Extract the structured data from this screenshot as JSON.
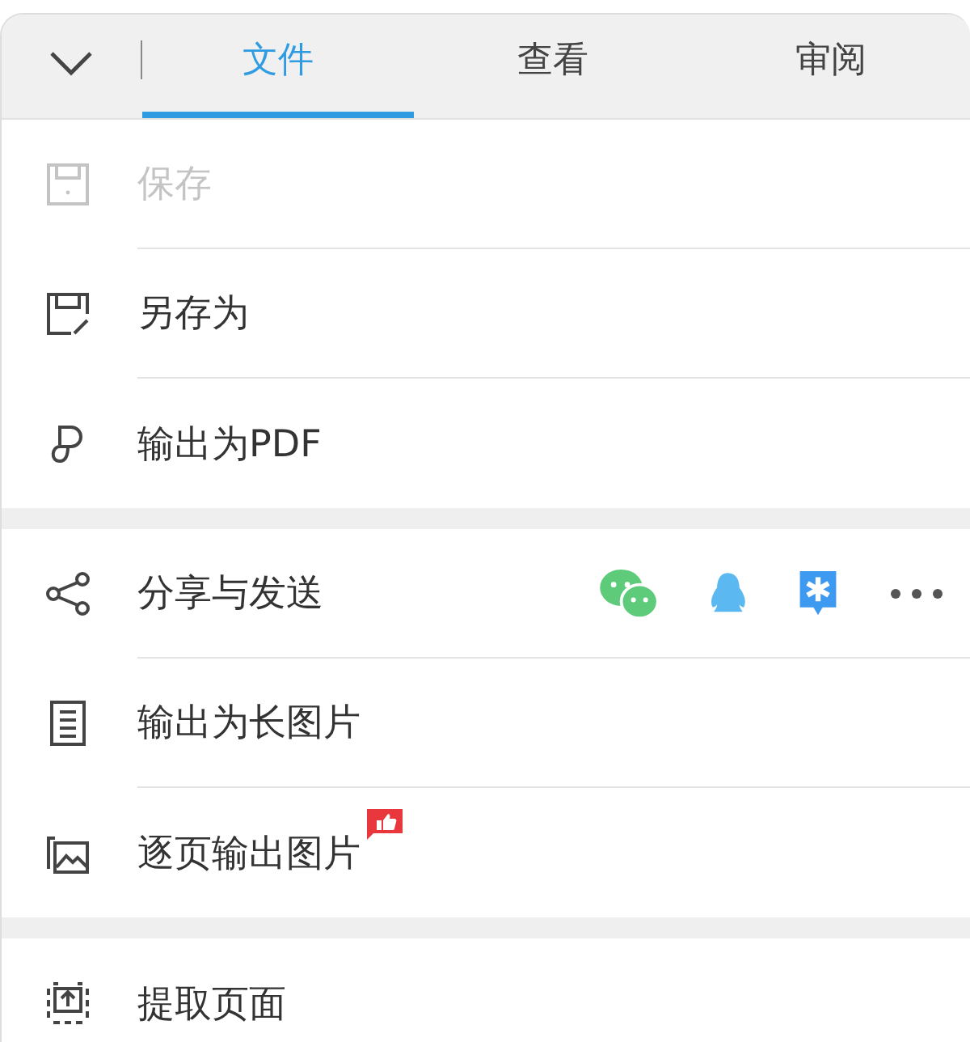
{
  "header": {
    "tabs": [
      {
        "label": "文件",
        "selected": true
      },
      {
        "label": "查看",
        "selected": false
      },
      {
        "label": "审阅",
        "selected": false
      }
    ]
  },
  "groups": [
    {
      "items": [
        {
          "kind": "save",
          "label": "保存",
          "disabled": true
        },
        {
          "kind": "saveas",
          "label": "另存为",
          "disabled": false
        },
        {
          "kind": "pdf",
          "label": "输出为PDF",
          "disabled": false
        }
      ]
    },
    {
      "items": [
        {
          "kind": "share",
          "label": "分享与发送",
          "disabled": false,
          "targets": [
            {
              "kind": "chat"
            },
            {
              "kind": "penguin"
            },
            {
              "kind": "star"
            },
            {
              "kind": "more"
            }
          ]
        },
        {
          "kind": "longimage",
          "label": "输出为长图片",
          "disabled": false
        },
        {
          "kind": "pageimages",
          "label": "逐页输出图片",
          "disabled": false,
          "badge": true
        }
      ]
    },
    {
      "items": [
        {
          "kind": "extract",
          "label": "提取页面",
          "disabled": false
        }
      ]
    }
  ]
}
